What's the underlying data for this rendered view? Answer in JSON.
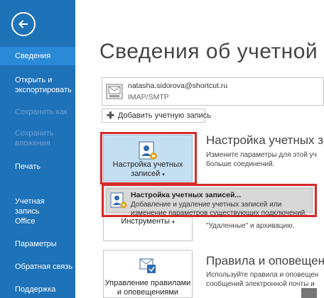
{
  "sidebar": {
    "back_icon": "back-arrow-icon",
    "items": [
      {
        "label": "Сведения",
        "state": "active"
      },
      {
        "label": "Открыть и экспортировать",
        "state": "normal"
      },
      {
        "label": "Сохранить как",
        "state": "disabled"
      },
      {
        "label": "Сохранить вложения",
        "state": "disabled"
      },
      {
        "label": "Печать",
        "state": "normal"
      },
      {
        "label": "Учетная запись Office",
        "state": "normal"
      },
      {
        "label": "Параметры",
        "state": "normal"
      },
      {
        "label": "Обратная связь",
        "state": "normal"
      },
      {
        "label": "Поддержка",
        "state": "normal"
      }
    ]
  },
  "main": {
    "title": "Сведения об учетной",
    "account": {
      "email": "natasha.sidorova@shortcut.ru",
      "type": "IMAP/SMTP"
    },
    "add_account_label": "Добавить учетную запись",
    "account_settings": {
      "tile_label_line1": "Настройка учетных",
      "tile_label_line2": "записей",
      "heading": "Настройка учетных зап",
      "desc_line1": "Измените параметры для этой уч",
      "desc_line2": "больше соединений."
    },
    "dropdown": {
      "title": "Настройка учетных записей...",
      "desc_line1": "Добавление и удаление учетных записей или",
      "desc_line2": "изменение параметров существующих подключений."
    },
    "tools": {
      "tile_label": "Инструменты",
      "desc": "\"Удаленные\" и архивацию."
    },
    "rules": {
      "tile_label_line1": "Управление правилами",
      "tile_label_line2": "и оповещениями",
      "heading": "Правила и оповещени",
      "desc_line1": "Используйте правила и оповещен",
      "desc_line2": "сообщений электронной почты и"
    }
  },
  "colors": {
    "sidebar_bg": "#1e72b8",
    "sidebar_active": "#2a8ad8",
    "highlight_red": "#d62a2a",
    "tile_selected": "#c5dff2"
  }
}
